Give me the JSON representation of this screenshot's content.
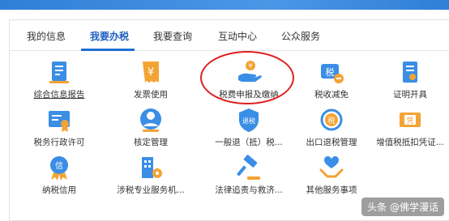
{
  "tabs": [
    {
      "label": "我的信息"
    },
    {
      "label": "我要办税"
    },
    {
      "label": "我要查询"
    },
    {
      "label": "互动中心"
    },
    {
      "label": "公众服务"
    }
  ],
  "active_tab": "我要办税",
  "services": [
    {
      "label": "综合信息报告",
      "icon": "report-icon"
    },
    {
      "label": "发票使用",
      "icon": "invoice-icon"
    },
    {
      "label": "税费申报及缴纳",
      "icon": "hand-coin-icon"
    },
    {
      "label": "税收减免",
      "icon": "tax-minus-icon"
    },
    {
      "label": "证明开具",
      "icon": "certificate-icon"
    },
    {
      "label": "税务行政许可",
      "icon": "license-icon"
    },
    {
      "label": "核定管理",
      "icon": "person-icon"
    },
    {
      "label": "一般退（抵）税...",
      "icon": "refund-shield-icon"
    },
    {
      "label": "出口退税管理",
      "icon": "export-refund-icon"
    },
    {
      "label": "增值税抵扣凭证...",
      "icon": "voucher-icon"
    },
    {
      "label": "纳税信用",
      "icon": "credit-icon"
    },
    {
      "label": "涉税专业服务机...",
      "icon": "building-gear-icon"
    },
    {
      "label": "法律追责与救济...",
      "icon": "gavel-icon"
    },
    {
      "label": "其他服务事项",
      "icon": "heart-hands-icon"
    }
  ],
  "watermark": "头条 @佛学漫话",
  "colors": {
    "accent": "#1f6fd0",
    "icon_blue": "#3a8ee6",
    "icon_orange": "#f3a334",
    "highlight_circle": "#e02020"
  }
}
